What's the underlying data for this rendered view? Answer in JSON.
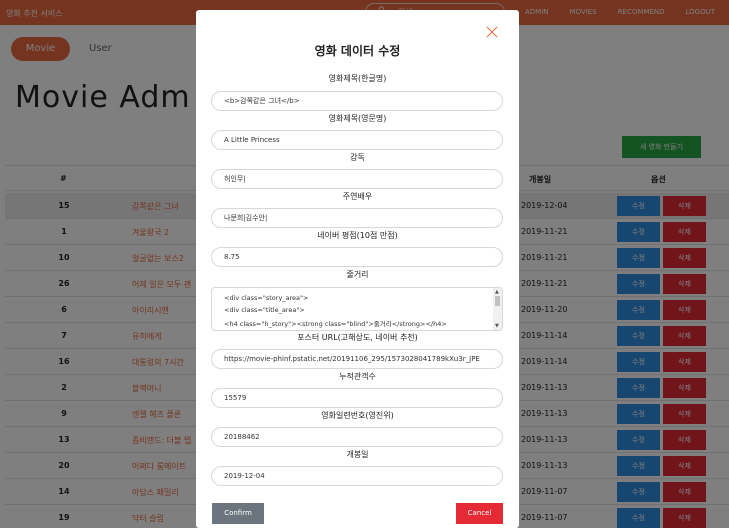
{
  "navbar": {
    "brand": "영화 추천 서비스",
    "search_placeholder": "검색",
    "links": [
      "ADMIN",
      "MOVIES",
      "RECOMMEND",
      "LOGOUT"
    ]
  },
  "tabs": {
    "movie": "Movie",
    "user": "User"
  },
  "page_title": "Movie Adm",
  "create_button": "새 영화 만들기",
  "table": {
    "headers": {
      "num": "#",
      "release": "개봉일",
      "options": "옵션"
    },
    "edit_label": "수정",
    "delete_label": "삭제",
    "rows": [
      {
        "num": "15",
        "title": "감쪽같은 그녀",
        "date": "2019-12-04"
      },
      {
        "num": "1",
        "title": "겨울왕국 2",
        "date": "2019-11-21"
      },
      {
        "num": "10",
        "title": "얼굴없는 보스2",
        "date": "2019-11-21"
      },
      {
        "num": "26",
        "title": "어제 일은 모두 괜",
        "date": "2019-11-21"
      },
      {
        "num": "6",
        "title": "아이리시맨",
        "date": "2019-11-20"
      },
      {
        "num": "7",
        "title": "유히에게",
        "date": "2019-11-14"
      },
      {
        "num": "16",
        "title": "대통령의 7시간",
        "date": "2019-11-14"
      },
      {
        "num": "2",
        "title": "블랙머니",
        "date": "2019-11-13"
      },
      {
        "num": "9",
        "title": "엔젤 해즈 폴른",
        "date": "2019-11-13"
      },
      {
        "num": "13",
        "title": "좀비랜드: 더블 탭",
        "date": "2019-11-13"
      },
      {
        "num": "20",
        "title": "어쩌다 룸메이트",
        "date": "2019-11-13"
      },
      {
        "num": "14",
        "title": "아담스 패밀리",
        "date": "2019-11-07"
      },
      {
        "num": "19",
        "title": "닥터 슬립",
        "date": "2019-11-07"
      }
    ]
  },
  "modal": {
    "title": "영화 데이터 수정",
    "fields": {
      "title_ko": {
        "label": "영화제목(한글명)",
        "value": "<b>감쪽같은 그녀</b>"
      },
      "title_en": {
        "label": "영화제목(영문명)",
        "value": "A Little Princess"
      },
      "director": {
        "label": "감독",
        "value": "허인무|"
      },
      "actors": {
        "label": "주연배우",
        "value": "나문희|김수안|"
      },
      "rating": {
        "label": "네이버 평점(10점 만점)",
        "value": "8.75"
      },
      "plot": {
        "label": "줄거리",
        "lines": [
          "<div class=\"story_area\">",
          "<div class=\"title_area\">",
          "<h4 class=\"h_story\"><strong class=\"blind\">줄거리</strong></h4>"
        ]
      },
      "poster": {
        "label": "포스터 URL(고해상도, 네이버 추천)",
        "value": "https://movie-phinf.pstatic.net/20191106_295/1573028041789kXu3r_JPE"
      },
      "audience": {
        "label": "누적관객수",
        "value": "15579"
      },
      "movie_code": {
        "label": "영화일련번호(영진위)",
        "value": "20188462"
      },
      "release": {
        "label": "개봉일",
        "value": "2019-12-04"
      }
    },
    "confirm": "Confirm",
    "cancel": "Cancel"
  },
  "colors": {
    "brand": "#e9683f",
    "edit": "#2e8fe0",
    "delete": "#e42a35",
    "create": "#28a745",
    "confirm": "#6c757d"
  }
}
